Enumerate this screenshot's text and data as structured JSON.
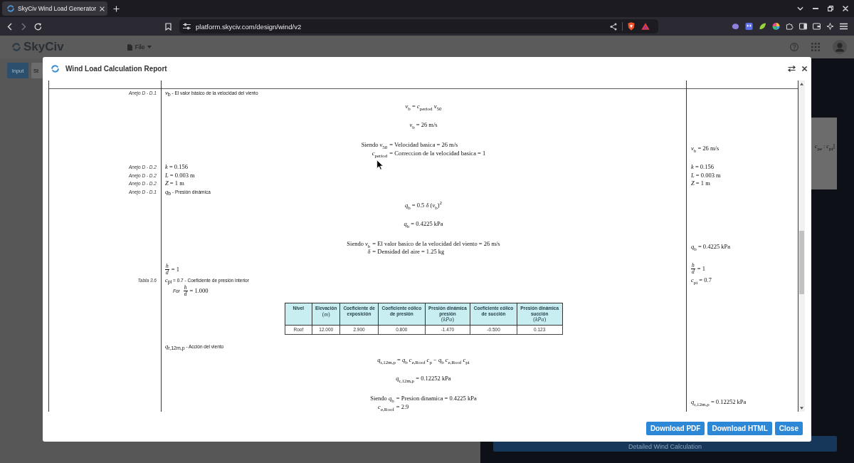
{
  "browser": {
    "tabs": [
      {
        "title": "SkyCiv Wind Load Generator",
        "selected": true
      }
    ],
    "address": "platform.skyciv.com/design/wind/v2"
  },
  "app": {
    "logo": "SkyCiv",
    "menu": "File",
    "tabs": [
      {
        "label": "Input",
        "selected": true
      },
      {
        "label": "St",
        "selected": false
      }
    ],
    "side_card": "*c*$_{pe}$ : *c*$_{pi}$]",
    "action_button": "Detailed Wind Calculation"
  },
  "modal": {
    "title": "Wind Load Calculation Report",
    "report": [
      {
        "ref": "Anejo D - D.1",
        "main": {
          "kind": "definition",
          "text": "*v*$_{b}$ - El valor básico de la velocidad del viento"
        }
      },
      {
        "main": {
          "kind": "equation",
          "text": "*v*$_{b}$ = *c*$_{period}$ *v*$_{50}$"
        }
      },
      {
        "main": {
          "kind": "equation",
          "text": "*v*$_{b}$ = 26 m/s"
        }
      },
      {
        "main": {
          "kind": "aligned",
          "lines": [
            {
              "lhs": "Siendo *v*$_{50}$",
              "rhs": "= Velocidad basica = 26 m/s"
            },
            {
              "lhs": "*c*$_{period}$",
              "rhs": "= Correccion de la velocidad basica = 1"
            }
          ]
        },
        "result": {
          "kind": "value",
          "text": "*v*$_{b}$ = 26 m/s"
        }
      },
      {
        "ref": "Anejo D - D.2",
        "main": {
          "kind": "value",
          "text": "*k* = 0.156"
        },
        "result": {
          "kind": "value",
          "text": "*k* = 0.156"
        }
      },
      {
        "ref": "Anejo D - D.2",
        "main": {
          "kind": "value",
          "text": "*L* = 0.003 m"
        },
        "result": {
          "kind": "value",
          "text": "*L* = 0.003 m"
        }
      },
      {
        "ref": "Anejo D - D.2",
        "main": {
          "kind": "value",
          "text": "*Z* = 1 m"
        },
        "result": {
          "kind": "value",
          "text": "*Z* = 1 m"
        }
      },
      {
        "ref": "Anejo D - D.1",
        "main": {
          "kind": "definition",
          "text": "*q*$_{b}$ - Presión dinámica"
        }
      },
      {
        "main": {
          "kind": "equation",
          "text": "*q*$_{b}$ = 0.5 *δ* (*v*$_{b}$)$^{2}$"
        }
      },
      {
        "main": {
          "kind": "equation",
          "text": "*q*$_{b}$ = 0.4225 kPa"
        }
      },
      {
        "main": {
          "kind": "aligned",
          "lines": [
            {
              "lhs": "Siendo *v*$_{b}$",
              "rhs": "= El valor basico de la velocidad del viento = 26 m/s"
            },
            {
              "lhs": "*δ*",
              "rhs": "= Densidad del aire = 1.25 kg"
            }
          ]
        },
        "result": {
          "kind": "value",
          "text": "*q*$_{b}$ = 0.4225 kPa"
        }
      },
      {
        "main": {
          "kind": "fraction",
          "numerator": "h",
          "denominator": "d",
          "text": "= 1"
        },
        "result": {
          "kind": "fraction",
          "numerator": "h",
          "denominator": "d",
          "text": "= 1"
        }
      },
      {
        "ref": "Tabla 3.6",
        "main": {
          "kind": "definition",
          "text": "*c*$_{pi}$ = 0.7 - Coeficiente de presión interior"
        },
        "result": {
          "kind": "value",
          "text": "*c*$_{pi}$ = 0.7"
        }
      },
      {
        "main": {
          "kind": "fraction",
          "prefix": "For",
          "numerator": "h",
          "denominator": "d",
          "text": "= 1.000"
        }
      },
      {
        "main": {
          "kind": "table",
          "columns": [
            {
              "label": "Nivel"
            },
            {
              "label": "Elevación",
              "unit": "(*m*)"
            },
            {
              "label": "Coeficiente de exposición"
            },
            {
              "label": "Coeficiente eólico de presión"
            },
            {
              "label": "Presión dinámica presión",
              "unit": "(*kPa*)"
            },
            {
              "label": "Coeficiente eólico de succión"
            },
            {
              "label": "Presión dinámica succión",
              "unit": "(*kPa*)"
            }
          ],
          "rows": [
            [
              "Roof",
              "12.000",
              "2.900",
              "0.800",
              "-1.470",
              "-0.500",
              "0.123"
            ]
          ]
        }
      },
      {
        "main": {
          "kind": "definition",
          "text": "*q*$_{r,12m,p}$ - Acción del viento"
        }
      },
      {
        "main": {
          "kind": "equation",
          "text": "*q*$_{r,12m,p}$ = *q*$_{b}$ *c*$_{e,Roof}$ *c*$_{p}$ − *q*$_{b}$ *c*$_{e,Roof}$ *c*$_{pi}$"
        }
      },
      {
        "main": {
          "kind": "equation",
          "text": "*q*$_{r,12m,p}$ = 0.12252 kPa"
        }
      },
      {
        "main": {
          "kind": "aligned",
          "lines": [
            {
              "lhs": "Siendo *q*$_{b}$",
              "rhs": "= Presion dinamica = 0.4225 kPa"
            },
            {
              "lhs": "*c*$_{e,Roof}$",
              "rhs": "= 2.9"
            }
          ]
        },
        "result": {
          "kind": "value",
          "text": "*q*$_{r,12m,p}$ = 0.12252 kPa"
        }
      }
    ],
    "buttons": [
      "Download PDF",
      "Download HTML",
      "Close"
    ]
  }
}
